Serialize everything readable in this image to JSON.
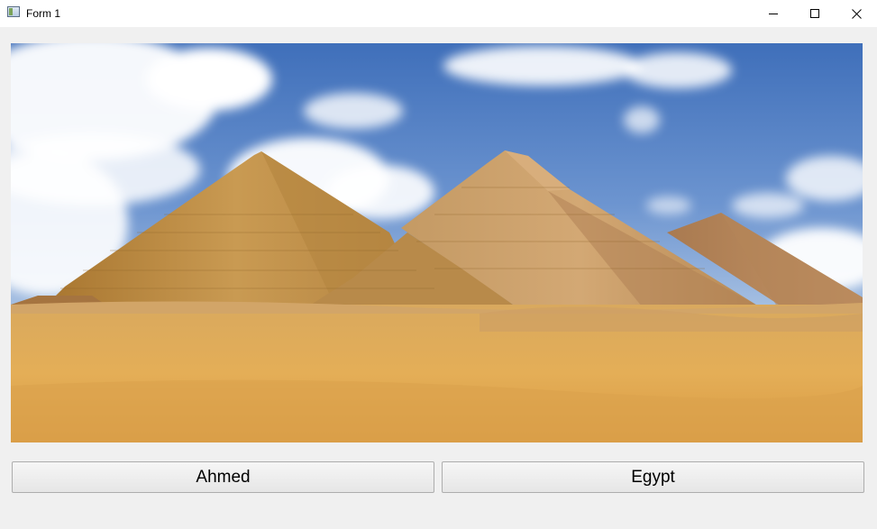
{
  "window": {
    "title": "Form 1",
    "icon": "form-app-icon",
    "controls": {
      "minimize_icon": "minimize-icon",
      "maximize_icon": "maximize-icon",
      "close_icon": "close-icon"
    }
  },
  "picture": {
    "subject": "pyramids-photo"
  },
  "buttons": {
    "left_label": "Ahmed",
    "right_label": "Egypt"
  },
  "colors": {
    "window_bg": "#f0f0f0",
    "titlebar_bg": "#ffffff",
    "sky": "#4a78c0",
    "sand": "#e0aa55",
    "button_border": "#adadad"
  }
}
